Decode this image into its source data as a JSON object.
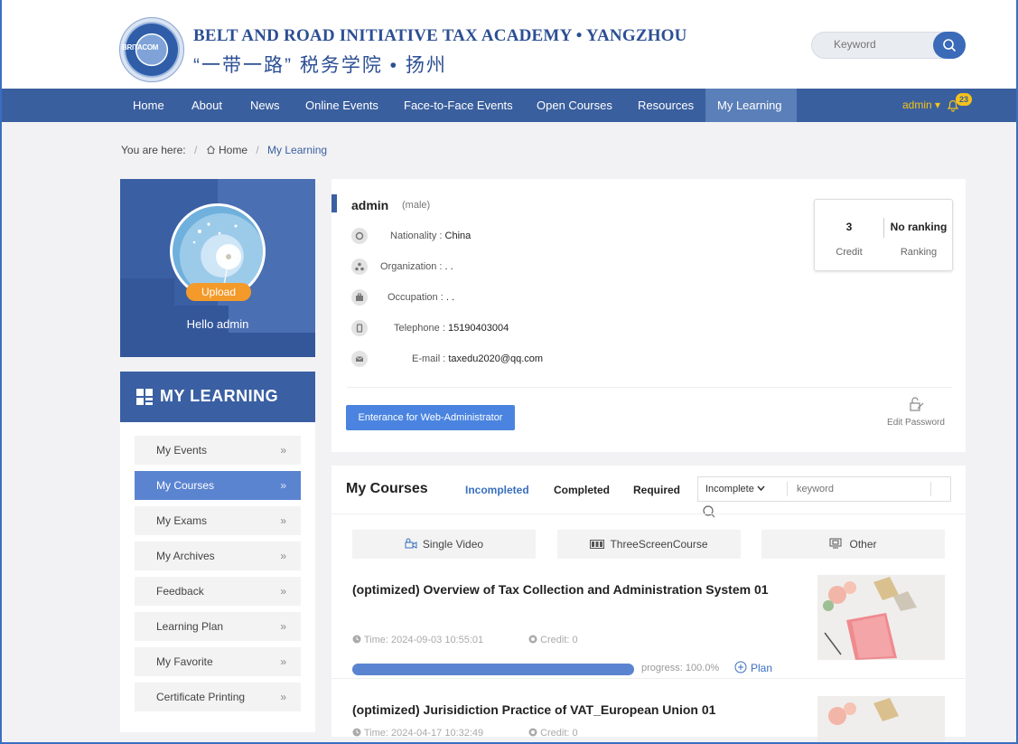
{
  "header": {
    "logo_text": "BRITACOM",
    "title_en": "BELT AND ROAD INITIATIVE TAX ACADEMY • YANGZHOU",
    "title_cn": "“一带一路” 税务学院 • 扬州",
    "search_placeholder": "Keyword"
  },
  "nav": {
    "items": [
      "Home",
      "About",
      "News",
      "Online Events",
      "Face-to-Face Events",
      "Open Courses",
      "Resources",
      "My Learning"
    ],
    "active": "My Learning",
    "user": "admin ▾",
    "notifications": "23"
  },
  "breadcrumb": {
    "prefix": "You are here:",
    "home": "Home",
    "current": "My Learning",
    "separator": "/"
  },
  "profile": {
    "upload_label": "Upload",
    "greeting": "Hello admin"
  },
  "sidebar": {
    "heading": "MY LEARNING",
    "items": [
      "My Events",
      "My Courses",
      "My Exams",
      "My Archives",
      "Feedback",
      "Learning Plan",
      "My Favorite",
      "Certificate Printing"
    ],
    "active": "My Courses",
    "arrow": "»"
  },
  "user_info": {
    "name": "admin",
    "gender": "(male)",
    "nationality_label": "Nationality :",
    "nationality": "China",
    "organization_label": "Organization :",
    "organization": ". .",
    "occupation_label": "Occupation :",
    "occupation": ". .",
    "telephone_label": "Telephone :",
    "telephone": "15190403004",
    "email_label": "E-mail :",
    "email": "taxedu2020@qq.com",
    "credit_value": "3",
    "credit_label": "Credit",
    "ranking_value": "No ranking",
    "ranking_label": "Ranking",
    "admin_button": "Enterance for Web-Administrator",
    "edit_password": "Edit Password"
  },
  "courses": {
    "title": "My Courses",
    "tabs": [
      "Incompleted",
      "Completed",
      "Required"
    ],
    "active_tab": "Incompleted",
    "filter_value": "Incomplete",
    "keyword_placeholder": "keyword",
    "type_tabs": [
      "Single Video",
      "ThreeScreenCourse",
      "Other"
    ],
    "list": [
      {
        "title": "(optimized) Overview of Tax Collection and Administration System 01",
        "time": "Time: 2024-09-03 10:55:01",
        "credit": "Credit: 0",
        "progress_text": "progress: 100.0%",
        "progress": 1.0,
        "plan_label": "Plan"
      },
      {
        "title": "(optimized) Jurisidiction Practice of VAT_European Union 01",
        "time": "Time: 2024-04-17 10:32:49",
        "credit": "Credit: 0"
      }
    ]
  },
  "colors": {
    "primary": "#3a5f9e",
    "accent": "#5b84d0",
    "upload": "#f39a2a",
    "user_name": "#f5c21b"
  }
}
